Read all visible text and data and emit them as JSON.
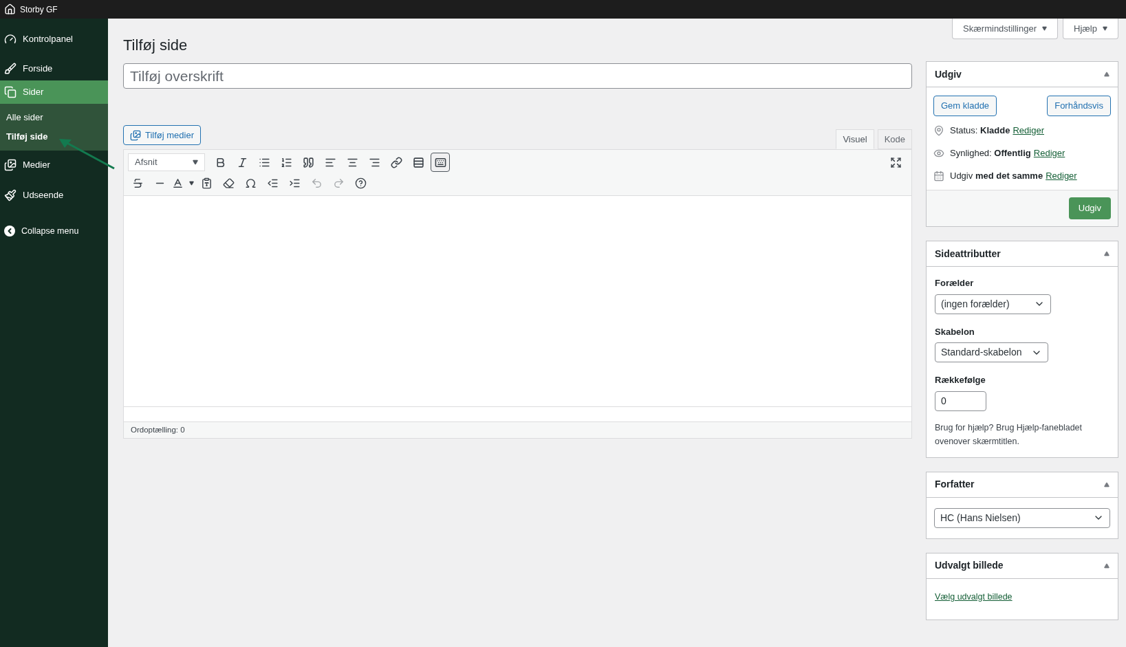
{
  "top_bar": {
    "site_name": "Storby GF"
  },
  "sidebar": {
    "items": [
      {
        "kind": "dashboard",
        "label": "Kontrolpanel",
        "selected": false
      },
      {
        "kind": "brush",
        "label": "Forside",
        "selected": false
      },
      {
        "kind": "pages",
        "label": "Sider",
        "selected": true,
        "children": [
          {
            "label": "Alle sider",
            "selected": false
          },
          {
            "label": "Tilføj side",
            "selected": true
          }
        ]
      },
      {
        "kind": "media",
        "label": "Medier",
        "selected": false
      },
      {
        "kind": "appearance",
        "label": "Udseende",
        "selected": false
      }
    ],
    "collapse": "Collapse menu"
  },
  "screen_buttons": [
    "Skærmindstillinger",
    "Hjælp"
  ],
  "page_title": "Tilføj side",
  "title_field": {
    "placeholder": "Tilføj overskrift"
  },
  "editor": {
    "add_media": "Tilføj medier",
    "tabs": [
      {
        "label": "Visuel",
        "selected": true
      },
      {
        "label": "Kode",
        "selected": false
      }
    ],
    "format": "Afsnit",
    "toolbar_row1": [
      {
        "kind": "bold",
        "pressed": false
      },
      {
        "kind": "italic",
        "pressed": false
      },
      {
        "kind": "bullets",
        "pressed": false
      },
      {
        "kind": "numbers",
        "pressed": false
      },
      {
        "kind": "quote",
        "pressed": false
      },
      {
        "kind": "align-left",
        "pressed": false
      },
      {
        "kind": "align-center",
        "pressed": false
      },
      {
        "kind": "align-right",
        "pressed": false
      },
      {
        "kind": "link",
        "pressed": false
      },
      {
        "kind": "more",
        "pressed": false
      },
      {
        "kind": "toolbar-toggle",
        "pressed": true
      }
    ],
    "toolbar_row2": [
      {
        "kind": "strikethrough",
        "disabled": false
      },
      {
        "kind": "hr",
        "disabled": false
      },
      {
        "kind": "text-color",
        "disabled": false
      },
      {
        "kind": "paste-text",
        "disabled": false
      },
      {
        "kind": "eraser",
        "disabled": false
      },
      {
        "kind": "omega",
        "disabled": false
      },
      {
        "kind": "outdent",
        "disabled": false
      },
      {
        "kind": "indent",
        "disabled": false
      },
      {
        "kind": "undo",
        "disabled": true
      },
      {
        "kind": "redo",
        "disabled": true
      },
      {
        "kind": "help",
        "disabled": false
      }
    ],
    "word_count": "Ordoptælling: 0"
  },
  "publish": {
    "title": "Udgiv",
    "save_draft": "Gem kladde",
    "preview": "Forhåndsvis",
    "rows": [
      {
        "kind": "status",
        "label": "Status:",
        "value": "Kladde",
        "link": "Rediger"
      },
      {
        "kind": "visibility",
        "label": "Synlighed:",
        "value": "Offentlig",
        "link": "Rediger"
      },
      {
        "kind": "schedule",
        "label": "Udgiv",
        "value": "med det samme",
        "link": "Rediger"
      }
    ],
    "publish_button": "Udgiv"
  },
  "page_attributes": {
    "title": "Sideattributter",
    "parent_label": "Forælder",
    "parent_value": "(ingen forælder)",
    "template_label": "Skabelon",
    "template_value": "Standard-skabelon",
    "order_label": "Rækkefølge",
    "order_value": "0",
    "help": "Brug for hjælp? Brug Hjælp-fanebladet ovenover skærmtitlen."
  },
  "author": {
    "title": "Forfatter",
    "value": "HC (Hans Nielsen)"
  },
  "featured_image": {
    "title": "Udvalgt billede",
    "link": "Vælg udvalgt billede"
  }
}
